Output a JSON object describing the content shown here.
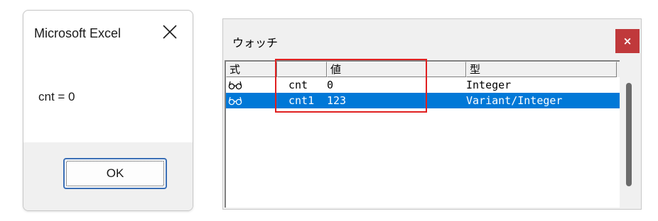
{
  "msgbox": {
    "title": "Microsoft Excel",
    "message": "cnt = 0",
    "ok_label": "OK"
  },
  "watch": {
    "title": "ウォッチ",
    "close_label": "×",
    "columns": {
      "expr": "式",
      "value": "値",
      "type": "型"
    },
    "rows": [
      {
        "name": "cnt",
        "value": "0",
        "type": "Integer",
        "icon": "glasses-icon"
      },
      {
        "name": "cnt1",
        "value": "123",
        "type": "Variant/Integer",
        "icon": "glasses-icon"
      }
    ]
  },
  "colors": {
    "selection": "#0078d7",
    "close_button": "#c0393b",
    "highlight": "#e02020",
    "ok_border": "#3b6fb6"
  }
}
